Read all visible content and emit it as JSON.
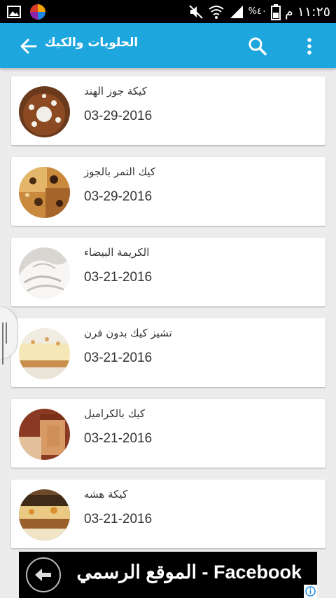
{
  "status_bar": {
    "time": "١١:٢٥ م",
    "battery_percent": "%٤٠",
    "icons": [
      "gallery-icon",
      "app-logo-icon",
      "mute-icon",
      "wifi-icon",
      "signal-icon",
      "battery-icon"
    ]
  },
  "app_bar": {
    "title": "الحلويات والكيك",
    "icons": [
      "back-arrow-icon",
      "search-icon",
      "overflow-menu-icon"
    ],
    "color": "#1ea6de"
  },
  "items": [
    {
      "title": "كيكة جوز الهند",
      "date": "03-29-2016"
    },
    {
      "title": "كيك التمر بالجوز",
      "date": "03-29-2016"
    },
    {
      "title": "الكريمة البيضاء",
      "date": "03-21-2016"
    },
    {
      "title": "تشيز كيك بدون فرن",
      "date": "03-21-2016"
    },
    {
      "title": "كيك بالكراميل",
      "date": "03-21-2016"
    },
    {
      "title": "كيكة هشه",
      "date": "03-21-2016"
    }
  ],
  "ad_banner": {
    "text": "Facebook - الموقع الرسمي",
    "icons": [
      "arrow-left-circle-icon",
      "adchoices-info-icon"
    ]
  }
}
